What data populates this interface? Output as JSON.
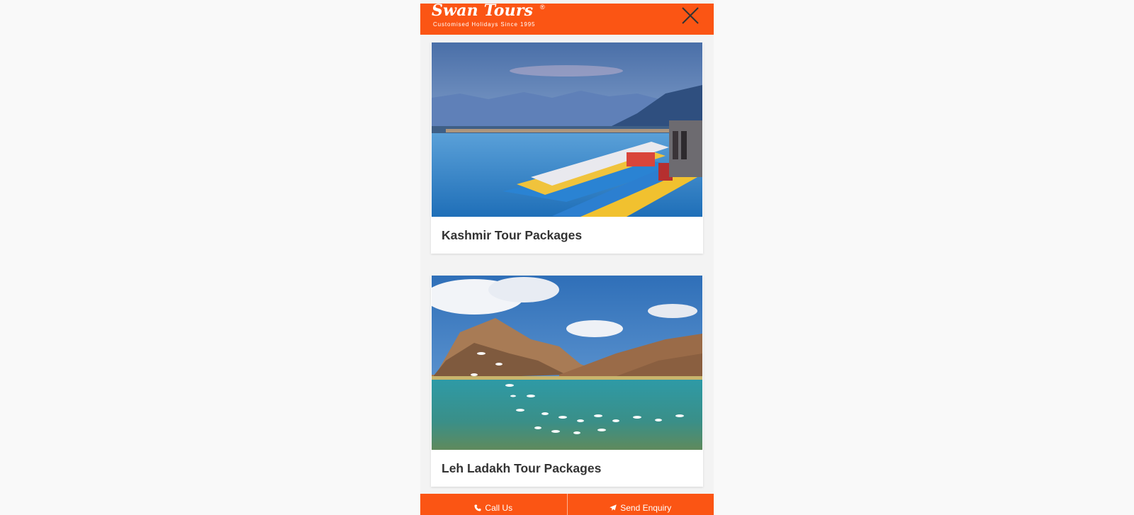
{
  "brand": {
    "name": "Swan Tours",
    "registered_mark": "®",
    "tagline": "Customised Holidays Since 1995",
    "color": "#fb5514"
  },
  "header": {
    "close_icon": "close-icon"
  },
  "cards": [
    {
      "title": "Kashmir Tour Packages",
      "image": "kashmir-dal-lake-shikara-boats"
    },
    {
      "title": "Leh Ladakh Tour Packages",
      "image": "ladakh-lake-mountains-birds"
    }
  ],
  "footer": {
    "call_label": "Call Us",
    "call_icon": "phone-icon",
    "enquiry_label": "Send Enquiry",
    "enquiry_icon": "paper-plane-icon"
  }
}
